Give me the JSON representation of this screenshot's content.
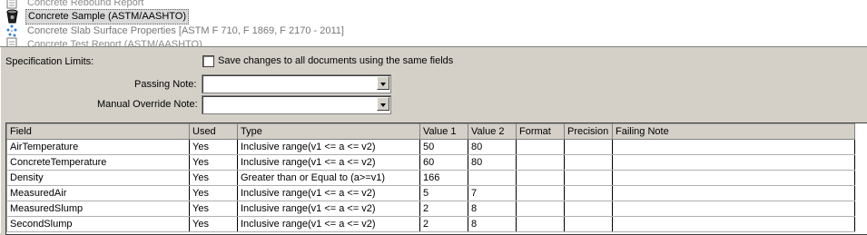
{
  "documents": [
    {
      "label": "Concrete Rebound Report",
      "icon": "document-icon",
      "state": "dim"
    },
    {
      "label": "Concrete Sample (ASTM/AASHTO)",
      "icon": "bucket-icon",
      "state": "selected"
    },
    {
      "label": "Concrete Slab Surface Properties [ASTM F 710, F 1869, F 2170 - 2011]",
      "icon": "dots-icon",
      "state": "gray"
    },
    {
      "label": "Concrete Test Report (ASTM/AASHTO)",
      "icon": "document-icon",
      "state": "dim"
    }
  ],
  "spec": {
    "title": "Specification Limits:",
    "save_checkbox_label": "Save changes to all documents using the same fields",
    "save_checked": false,
    "passing_note_label": "Passing Note:",
    "passing_note_value": "",
    "override_note_label": "Manual Override Note:",
    "override_note_value": ""
  },
  "grid": {
    "columns": [
      "Field",
      "Used",
      "Type",
      "Value 1",
      "Value 2",
      "Format",
      "Precision",
      "Failing Note"
    ],
    "rows": [
      [
        "AirTemperature",
        "Yes",
        "Inclusive range(v1 <= a <= v2)",
        "50",
        "80",
        "",
        "",
        ""
      ],
      [
        "ConcreteTemperature",
        "Yes",
        "Inclusive range(v1 <= a <= v2)",
        "60",
        "80",
        "",
        "",
        ""
      ],
      [
        "Density",
        "Yes",
        "Greater than or Equal to (a>=v1)",
        "166",
        "",
        "",
        "",
        ""
      ],
      [
        "MeasuredAir",
        "Yes",
        "Inclusive range(v1 <= a <= v2)",
        "5",
        "7",
        "",
        "",
        ""
      ],
      [
        "MeasuredSlump",
        "Yes",
        "Inclusive range(v1 <= a <= v2)",
        "2",
        "8",
        "",
        "",
        ""
      ],
      [
        "SecondSlump",
        "Yes",
        "Inclusive range(v1 <= a <= v2)",
        "2",
        "8",
        "",
        "",
        ""
      ]
    ]
  }
}
